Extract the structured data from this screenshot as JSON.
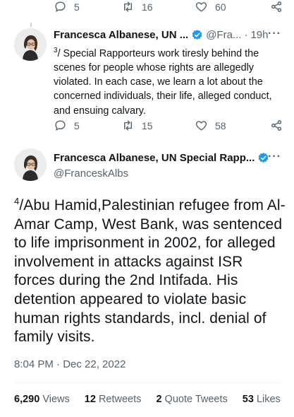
{
  "top_action_bar": {
    "reply_count": "5",
    "retweet_count": "16",
    "like_count": "60"
  },
  "reply_tweet": {
    "author_name": "Francesca Albanese, UN ...",
    "author_handle": "@Fra...",
    "separator": "·",
    "time_ago": "19h",
    "more": "···",
    "number_prefix": "3",
    "text": "/ Special Rapporteurs work tiresly behind the scenes for people whose rights are allegedly violated. In each case, we learn a lot about the concerned individuals, their life, alleged conduct, and ensuing calvary.",
    "reply_count": "5",
    "retweet_count": "15",
    "like_count": "58"
  },
  "main_tweet": {
    "author_name": "Francesca Albanese, UN Special Rapp...",
    "author_handle": "@FranceskAlbs",
    "more": "···",
    "number_prefix": "4",
    "text": "/Abu Hamid,Palestinian refugee from Al-Amar Camp, West Bank, was sentenced to life imprisonment in 2002, for alleged involvement in attacks against ISR forces during the 2nd Intifada. His detention appeared to violate basic human rights standards, incl. denial of family visits.",
    "timestamp": "8:04 PM · Dec 22, 2022",
    "stats": {
      "views_count": "6,290",
      "views_label": "Views",
      "retweets_count": "12",
      "retweets_label": "Retweets",
      "quotes_count": "2",
      "quotes_label": "Quote Tweets",
      "likes_count": "53",
      "likes_label": "Likes"
    }
  },
  "colors": {
    "text_primary": "#0f1419",
    "text_secondary": "#536471",
    "verified_badge": "#1d9bf0",
    "thread_line": "#cfd9de",
    "divider": "#eff3f4"
  },
  "icons": [
    "reply-icon",
    "retweet-icon",
    "like-icon",
    "share-icon",
    "verified-badge-icon",
    "more-options-icon"
  ]
}
